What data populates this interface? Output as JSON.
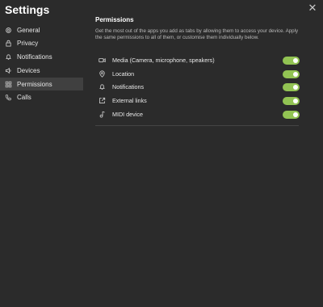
{
  "window": {
    "title": "Settings"
  },
  "sidebar": {
    "items": [
      {
        "label": "General",
        "icon": "gear-icon"
      },
      {
        "label": "Privacy",
        "icon": "lock-icon"
      },
      {
        "label": "Notifications",
        "icon": "bell-icon"
      },
      {
        "label": "Devices",
        "icon": "speaker-icon"
      },
      {
        "label": "Permissions",
        "icon": "grid-icon",
        "active": true
      },
      {
        "label": "Calls",
        "icon": "phone-icon"
      }
    ]
  },
  "permissions": {
    "heading": "Permissions",
    "description": "Get the most out of the apps you add as tabs by allowing them to access your device. Apply the same permissions to all of them, or customise them individually below.",
    "items": [
      {
        "label": "Media (Camera, microphone, speakers)",
        "icon": "camera-icon",
        "enabled": true
      },
      {
        "label": "Location",
        "icon": "location-icon",
        "enabled": true
      },
      {
        "label": "Notifications",
        "icon": "bell-icon",
        "enabled": true
      },
      {
        "label": "External links",
        "icon": "external-link-icon",
        "enabled": true
      },
      {
        "label": "MIDI device",
        "icon": "music-note-icon",
        "enabled": true
      }
    ]
  },
  "colors": {
    "toggle_on": "#92c353",
    "background": "#2b2b2b",
    "active_nav": "#404040"
  }
}
